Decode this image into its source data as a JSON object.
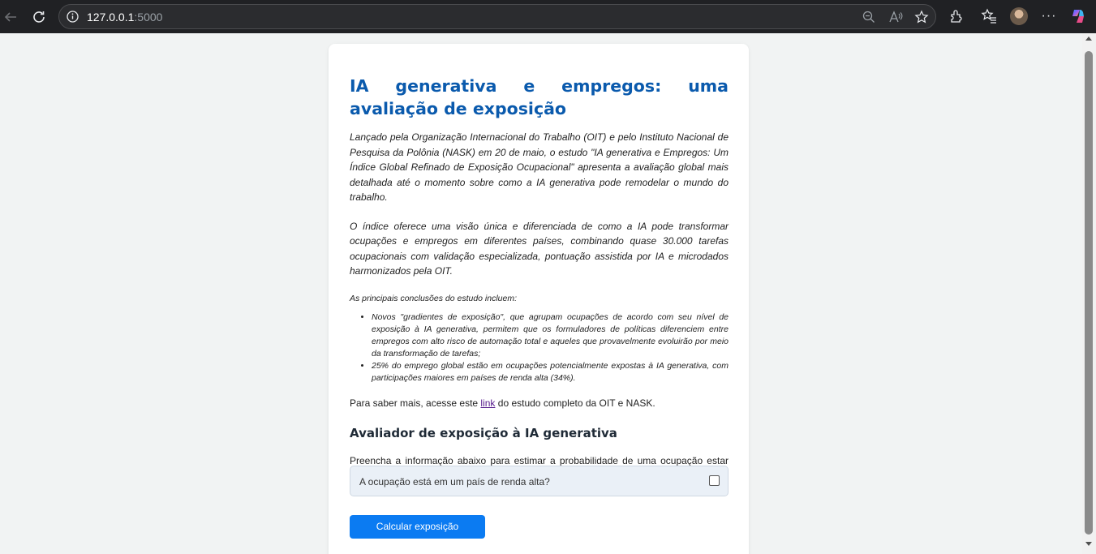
{
  "browser": {
    "url_host": "127.0.0.1",
    "url_port": ":5000",
    "icons": [
      "back-arrow-icon",
      "reload-icon",
      "info-icon",
      "zoom-out-icon",
      "read-aloud-icon",
      "favorite-star-icon",
      "extensions-icon",
      "favorites-icon",
      "avatar",
      "more-icon",
      "copilot-icon"
    ],
    "more_label": "···"
  },
  "page": {
    "title": "IA generativa e empregos: uma avaliação de exposição",
    "intro_p1": "Lançado pela Organização Internacional do Trabalho (OIT) e pelo Instituto Nacional de Pesquisa da Polônia (NASK) em 20 de maio, o estudo \"IA generativa e Empregos: Um Índice Global Refinado de Exposição Ocupacional\" apresenta a avaliação global mais detalhada até o momento sobre como a IA generativa pode remodelar o mundo do trabalho.",
    "intro_p2": "O índice oferece uma visão única e diferenciada de como a IA pode transformar ocupações e empregos em diferentes países, combinando quase 30.000 tarefas ocupacionais com validação especializada, pontuação assistida por IA e microdados harmonizados pela OIT.",
    "findings_lead": "As principais conclusões do estudo incluem:",
    "findings": [
      "Novos \"gradientes de exposição\", que agrupam ocupações de acordo com seu nível de exposição à IA generativa, permitem que os formuladores de políticas diferenciem entre empregos com alto risco de automação total e aqueles que provavelmente evoluirão por meio da transformação de tarefas;",
      "25% do emprego global estão em ocupações potencialmente expostas à IA generativa, com participações maiores em países de renda alta (34%)."
    ],
    "more_info_before": "Para saber mais, acesse este ",
    "more_info_link": "link",
    "more_info_after": " do estudo completo da OIT e NASK.",
    "evaluator_title": "Avaliador de exposição à IA generativa",
    "evaluator_desc": "Preencha a informação abaixo para estimar a probabilidade de uma ocupação estar potencialmente exposta à IA generativa:",
    "checkbox_label": "A ocupação está em um país de renda alta?",
    "checkbox_checked": false,
    "button_label": "Calcular exposição"
  },
  "colors": {
    "title": "#0a5aad",
    "button": "#0b7bf2",
    "link": "#551a8b",
    "checkbox_row": "#eaf0f7"
  }
}
